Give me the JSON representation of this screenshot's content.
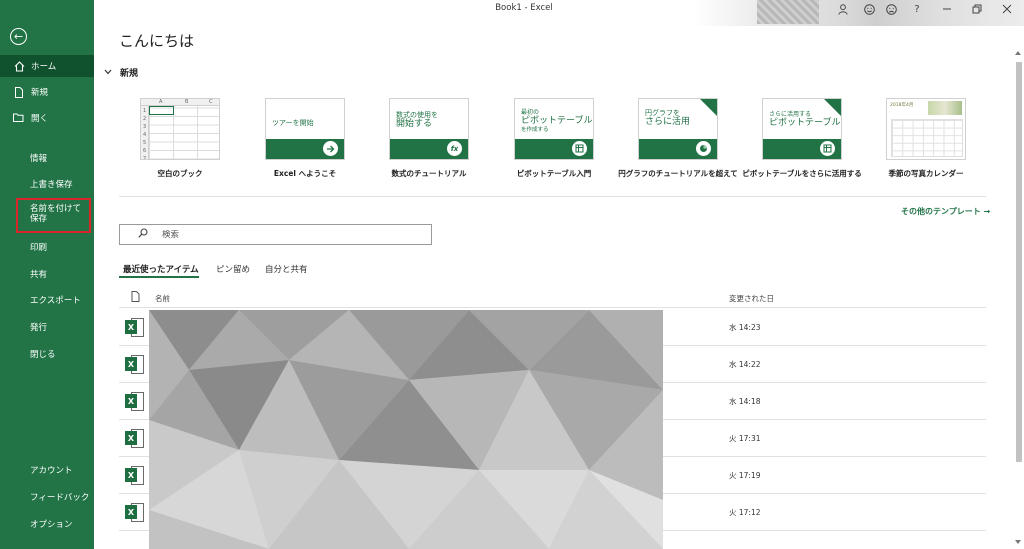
{
  "window": {
    "title": "Book1  -  Excel"
  },
  "titlebar": {
    "help": "?"
  },
  "sidebar": {
    "back_glyph": "←",
    "home": "ホーム",
    "new": "新規",
    "open": "開く",
    "info": "情報",
    "save": "上書き保存",
    "save_as": "名前を付けて保存",
    "print": "印刷",
    "share": "共有",
    "export": "エクスポート",
    "publish": "発行",
    "close": "閉じる",
    "account": "アカウント",
    "feedback": "フィードバック",
    "options": "オプション"
  },
  "greeting": "こんにちは",
  "new_section": {
    "title": "新規"
  },
  "templates": [
    {
      "caption": "空白のブック"
    },
    {
      "caption": "Excel へようこそ",
      "thumb_line1": "ツアーを開始"
    },
    {
      "caption": "数式のチュートリアル",
      "thumb_line1": "数式の使用を",
      "thumb_line2": "開始する",
      "circle": "fx"
    },
    {
      "caption": "ピボットテーブル入門",
      "thumb_line1": "最初の",
      "thumb_line2": "ピボットテーブル",
      "thumb_line3": "を作成する"
    },
    {
      "caption": "円グラフのチュートリアルを超えて",
      "thumb_line1": "円グラフを",
      "thumb_line2": "さらに活用"
    },
    {
      "caption": "ピボットテーブルをさらに活用する",
      "thumb_line1": "さらに活用する",
      "thumb_line2": "ピボットテーブル"
    },
    {
      "caption": "季節の写真カレンダー",
      "thumb_line1": "2018年4月"
    }
  ],
  "blank_grid": {
    "cols": [
      "A",
      "B",
      "C"
    ],
    "rows": [
      "1",
      "2",
      "3",
      "4",
      "5",
      "6",
      "7"
    ]
  },
  "more_templates": "その他のテンプレート →",
  "search": {
    "placeholder": "検索"
  },
  "tabs": {
    "recent": "最近使ったアイテム",
    "pinned": "ピン留め",
    "shared": "自分と共有"
  },
  "list": {
    "col_name": "名前",
    "col_modified": "変更された日",
    "rows": [
      {
        "date": "水 14:23"
      },
      {
        "date": "水 14:22"
      },
      {
        "date": "水 14:18"
      },
      {
        "date": "火 17:31"
      },
      {
        "date": "火 17:19"
      },
      {
        "date": "火 17:12"
      }
    ]
  },
  "icons": {
    "back": "arrow-left-circle-icon",
    "home": "home-icon",
    "new": "document-icon",
    "open": "folder-icon"
  },
  "colors": {
    "excel_green": "#217346",
    "sidebar": "#227447",
    "highlight_box": "#d9262b"
  }
}
